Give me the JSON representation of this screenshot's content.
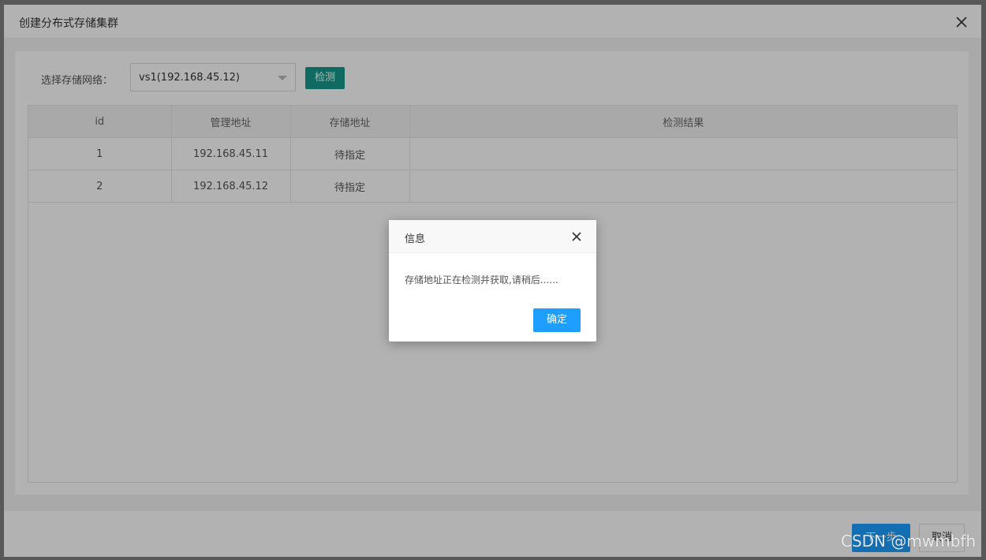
{
  "dialog": {
    "title": "创建分布式存储集群",
    "close_icon": "close-icon"
  },
  "network": {
    "label": "选择存储网络：",
    "selected": "vs1(192.168.45.12)",
    "detect_label": "检测"
  },
  "table": {
    "headers": [
      "id",
      "管理地址",
      "存储地址",
      "检测结果"
    ],
    "rows": [
      {
        "id": "1",
        "mgmt": "192.168.45.11",
        "storage": "待指定",
        "result": ""
      },
      {
        "id": "2",
        "mgmt": "192.168.45.12",
        "storage": "待指定",
        "result": ""
      }
    ]
  },
  "footer": {
    "next_label": "下一步",
    "cancel_label": "取消"
  },
  "message": {
    "title": "信息",
    "text": "存储地址正在检测并获取,请稍后......",
    "ok_label": "确定"
  },
  "watermark": "CSDN @mwmbfh",
  "colors": {
    "primary": "#1e9fff",
    "detect": "#169a8c"
  }
}
